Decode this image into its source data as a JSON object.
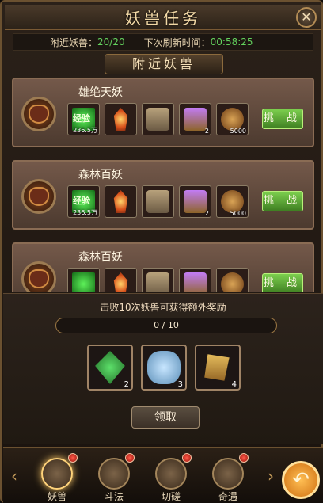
{
  "window": {
    "title": "妖兽任务",
    "close_label": "✕"
  },
  "status": {
    "nearby_label": "附近妖兽：",
    "nearby_value": "20/20",
    "refresh_label": "下次刷新时间：",
    "refresh_value": "00:58:25"
  },
  "section": {
    "title": "附近妖兽"
  },
  "colors": {
    "accent": "#63d25d",
    "gold": "#c49b5a",
    "button_green": "#5ea63a"
  },
  "tasks": [
    {
      "name": "雄绝天妖",
      "challenge_label": "挑 战",
      "rewards": [
        {
          "icon": "exp-icon",
          "label": "经验",
          "qty": "236.5万"
        },
        {
          "icon": "flame-crystal-icon",
          "qty": ""
        },
        {
          "icon": "stone-box-icon",
          "qty": ""
        },
        {
          "icon": "treasure-chest-icon",
          "qty": "2"
        },
        {
          "icon": "coin-icon",
          "qty": "5000"
        }
      ]
    },
    {
      "name": "森林百妖",
      "challenge_label": "挑 战",
      "rewards": [
        {
          "icon": "exp-icon",
          "label": "经验",
          "qty": "236.5万"
        },
        {
          "icon": "flame-crystal-icon",
          "qty": ""
        },
        {
          "icon": "stone-box-icon",
          "qty": ""
        },
        {
          "icon": "treasure-chest-icon",
          "qty": "2"
        },
        {
          "icon": "coin-icon",
          "qty": "5000"
        }
      ]
    },
    {
      "name": "森林百妖",
      "challenge_label": "挑 战",
      "rewards": [
        {
          "icon": "exp-icon",
          "label": "",
          "qty": ""
        },
        {
          "icon": "flame-crystal-icon",
          "qty": ""
        },
        {
          "icon": "stone-box-icon",
          "qty": ""
        },
        {
          "icon": "treasure-chest-icon",
          "qty": ""
        },
        {
          "icon": "coin-icon",
          "qty": ""
        }
      ]
    }
  ],
  "bonus": {
    "text": "击败10次妖兽可获得额外奖励",
    "progress_text": "0 / 10",
    "progress": 0.0,
    "items": [
      {
        "icon": "green-gem-icon",
        "qty": "2"
      },
      {
        "icon": "blue-stone-icon",
        "qty": "3"
      },
      {
        "icon": "gold-token-icon",
        "qty": "4"
      }
    ],
    "claim_label": "领取"
  },
  "tabs": [
    {
      "label": "妖兽",
      "icon": "eye-icon",
      "active": true,
      "badge": true
    },
    {
      "label": "斗法",
      "icon": "gear-fist-icon",
      "active": false,
      "badge": true
    },
    {
      "label": "切磋",
      "icon": "swords-icon",
      "active": false,
      "badge": true
    },
    {
      "label": "奇遇",
      "icon": "chest-encounter-icon",
      "active": false,
      "badge": true
    }
  ],
  "nav": {
    "left_arrow": "‹",
    "right_arrow": "›",
    "back_label": "↶"
  }
}
